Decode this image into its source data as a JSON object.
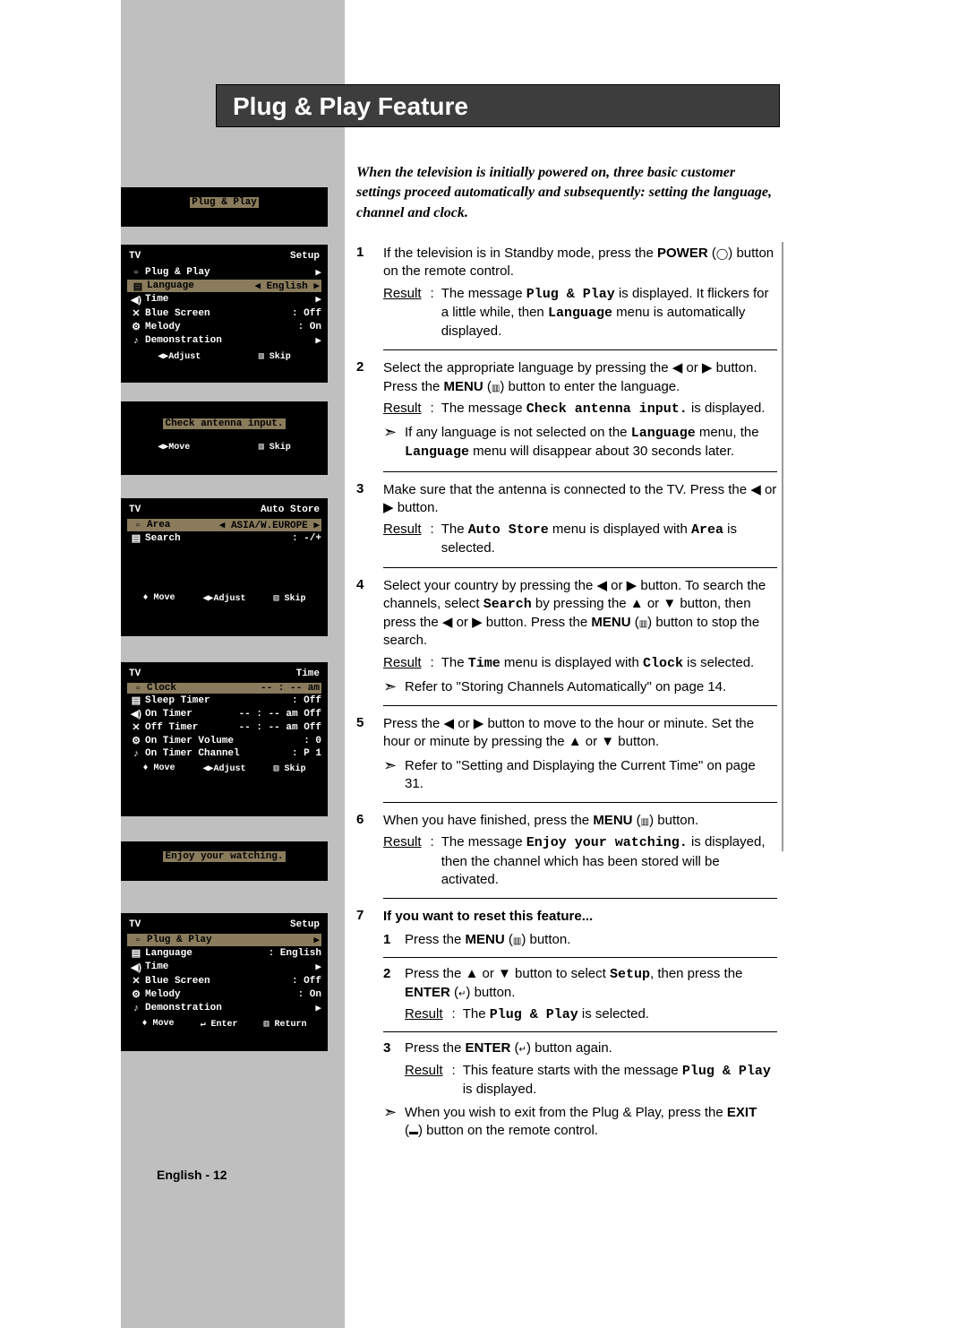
{
  "page_title": "Plug & Play Feature",
  "intro": "When the television is initially powered on, three basic customer settings proceed automatically and subsequently: setting the language, channel and clock.",
  "steps": {
    "s1": {
      "num": "1",
      "text_a": "If the television is in Standby mode, press the ",
      "text_b": "POWER",
      "text_c": " button on the remote control.",
      "result_label": "Result",
      "result_text_a": "The message ",
      "result_mono": "Plug & Play",
      "result_text_b": " is displayed. It flickers for a little while, then ",
      "result_mono2": "Language",
      "result_text_c": " menu is automatically displayed."
    },
    "s2": {
      "num": "2",
      "text_a": "Select the appropriate language by pressing the ◀ or ▶ button. Press the ",
      "text_b": "MENU",
      "text_c": " button to enter the language.",
      "result_label": "Result",
      "result_text_a": "The message ",
      "result_mono": "Check antenna input.",
      "result_text_b": " is displayed.",
      "note_a": "If any language is not selected on the ",
      "note_mono": "Language",
      "note_b": " menu, the ",
      "note_mono2": "Language",
      "note_c": " menu will disappear about 30 seconds later."
    },
    "s3": {
      "num": "3",
      "text": "Make sure that the antenna is connected to the TV. Press the ◀ or ▶ button.",
      "result_label": "Result",
      "result_text_a": "The ",
      "result_mono": "Auto Store",
      "result_text_b": " menu is displayed with ",
      "result_mono2": "Area",
      "result_text_c": " is selected."
    },
    "s4": {
      "num": "4",
      "text_a": "Select your country by pressing the ◀ or ▶ button. To search the channels, select ",
      "mono1": "Search",
      "text_b": " by pressing the ▲ or ▼ button, then press the ◀ or ▶ button. Press the ",
      "bold1": "MENU",
      "text_c": " button to stop the search.",
      "result_label": "Result",
      "result_text_a": "The ",
      "result_mono": "Time",
      "result_text_b": " menu is displayed with ",
      "result_mono2": "Clock",
      "result_text_c": " is selected.",
      "note": "Refer to \"Storing Channels Automatically\" on page 14."
    },
    "s5": {
      "num": "5",
      "text": "Press the ◀ or ▶ button to move to the hour or minute. Set the hour or minute by pressing the ▲ or ▼ button.",
      "note": "Refer to \"Setting and Displaying the Current Time\" on page 31."
    },
    "s6": {
      "num": "6",
      "text_a": "When you have finished, press the ",
      "bold1": "MENU",
      "text_b": " button.",
      "result_label": "Result",
      "result_text_a": "The message ",
      "result_mono": "Enjoy your watching.",
      "result_text_b": " is displayed, then the channel which has been stored will be activated."
    },
    "s7": {
      "num": "7",
      "heading": "If you want to reset this feature...",
      "sub1_num": "1",
      "sub1_a": "Press the ",
      "sub1_b": "MENU",
      "sub1_c": " button.",
      "sub2_num": "2",
      "sub2_a": "Press the ▲ or ▼ button to select ",
      "sub2_mono": "Setup",
      "sub2_b": ", then press the ",
      "sub2_bold": "ENTER",
      "sub2_c": " button.",
      "sub2_result_label": "Result",
      "sub2_result_a": "The ",
      "sub2_result_mono": "Plug & Play",
      "sub2_result_b": " is selected.",
      "sub3_num": "3",
      "sub3_a": "Press the ",
      "sub3_b": "ENTER",
      "sub3_c": " button again.",
      "sub3_result_label": "Result",
      "sub3_result_a": "This feature starts with the message ",
      "sub3_result_mono": "Plug & Play",
      "sub3_result_b": " is displayed.",
      "note_a": "When you wish to exit from the Plug & Play, press the ",
      "note_bold": "EXIT",
      "note_b": " button on the remote control."
    }
  },
  "footer": "English - 12",
  "osd": {
    "box1": {
      "text": "Plug & Play"
    },
    "box2": {
      "tv": "TV",
      "title": "Setup",
      "items": [
        {
          "label": "Plug & Play",
          "val": "▶"
        },
        {
          "label": "Language",
          "val": "◀ English  ▶",
          "hl": true
        },
        {
          "label": "Time",
          "val": "▶"
        },
        {
          "label": "Blue Screen",
          "val": ": Off"
        },
        {
          "label": "Melody",
          "val": ": On"
        },
        {
          "label": "Demonstration",
          "val": "▶"
        }
      ],
      "footer_l": "◀▶Adjust",
      "footer_r": "▥ Skip"
    },
    "box3": {
      "text": "Check antenna input.",
      "footer_l": "◀▶Move",
      "footer_r": "▥ Skip"
    },
    "box4": {
      "tv": "TV",
      "title": "Auto Store",
      "items": [
        {
          "label": "Area",
          "val": "◀ ASIA/W.EUROPE ▶",
          "hl": true
        },
        {
          "label": "Search",
          "val": ": -/+"
        }
      ],
      "footer_l": "♦ Move",
      "footer_m": "◀▶Adjust",
      "footer_r": "▥ Skip"
    },
    "box5": {
      "tv": "TV",
      "title": "Time",
      "items": [
        {
          "label": "Clock",
          "val": "-- : --   am",
          "hl": true
        },
        {
          "label": "Sleep Timer",
          "val": ": Off"
        },
        {
          "label": "On Timer",
          "val": "-- : -- am Off"
        },
        {
          "label": "Off Timer",
          "val": "-- : -- am Off"
        },
        {
          "label": "On Timer Volume",
          "val": ":   0"
        },
        {
          "label": "On Timer Channel",
          "val": ":  P 1"
        }
      ],
      "footer_l": "♦ Move",
      "footer_m": "◀▶Adjust",
      "footer_r": "▥ Skip"
    },
    "box6": {
      "text": "Enjoy your watching."
    },
    "box7": {
      "tv": "TV",
      "title": "Setup",
      "items": [
        {
          "label": "Plug & Play",
          "val": "▶",
          "hl": true
        },
        {
          "label": "Language",
          "val": ": English"
        },
        {
          "label": "Time",
          "val": "▶"
        },
        {
          "label": "Blue Screen",
          "val": ": Off"
        },
        {
          "label": "Melody",
          "val": ": On"
        },
        {
          "label": "Demonstration",
          "val": "▶"
        }
      ],
      "footer_l": "♦ Move",
      "footer_m": "↵ Enter",
      "footer_r": "▥ Return"
    }
  }
}
